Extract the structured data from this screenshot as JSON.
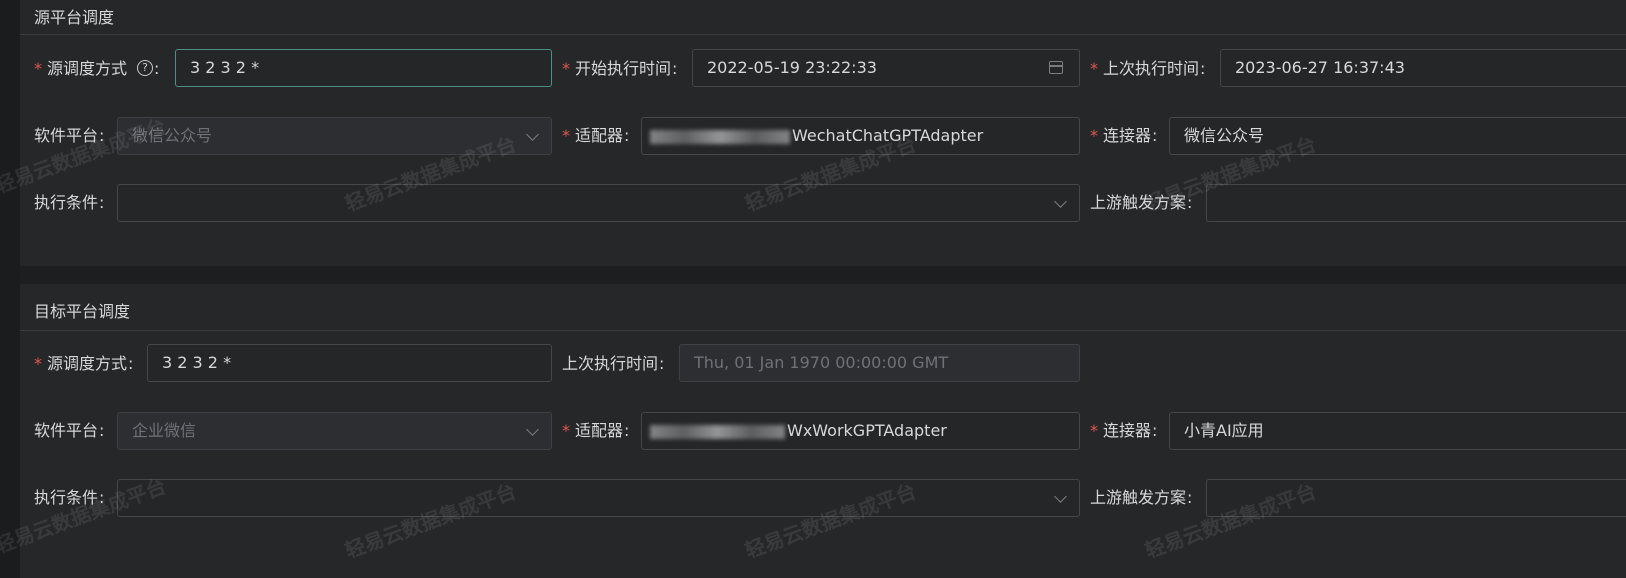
{
  "source": {
    "title": "源平台调度",
    "schedule_label": "源调度方式",
    "schedule_value": "3 2 3 2 *",
    "start_time_label": "开始执行时间",
    "start_time_value": "2022-05-19 23:22:33",
    "last_run_label": "上次执行时间",
    "last_run_value": "2023-06-27 16:37:43",
    "platform_label": "软件平台",
    "platform_value": "微信公众号",
    "adapter_label": "适配器",
    "adapter_value": "WechatChatGPTAdapter",
    "connector_label": "连接器",
    "connector_value": "微信公众号",
    "condition_label": "执行条件",
    "upstream_label": "上游触发方案"
  },
  "target": {
    "title": "目标平台调度",
    "schedule_label": "源调度方式",
    "schedule_value": "3 2 3 2 *",
    "last_run_label": "上次执行时间",
    "last_run_placeholder": "Thu, 01 Jan 1970 00:00:00 GMT",
    "platform_label": "软件平台",
    "platform_value": "企业微信",
    "adapter_label": "适配器",
    "adapter_value": "WxWorkGPTAdapter",
    "connector_label": "连接器",
    "connector_value": "小青AI应用",
    "condition_label": "执行条件",
    "upstream_label": "上游触发方案"
  },
  "watermark_text": "轻易云数据集成平台",
  "icons": {
    "help": "question-circle-icon",
    "calendar": "calendar-icon",
    "dropdown": "chevron-down-icon"
  },
  "colors": {
    "required": "#e4554f",
    "focus_border": "#4b8f88",
    "background": "#1c1e20",
    "panel": "#252729"
  }
}
